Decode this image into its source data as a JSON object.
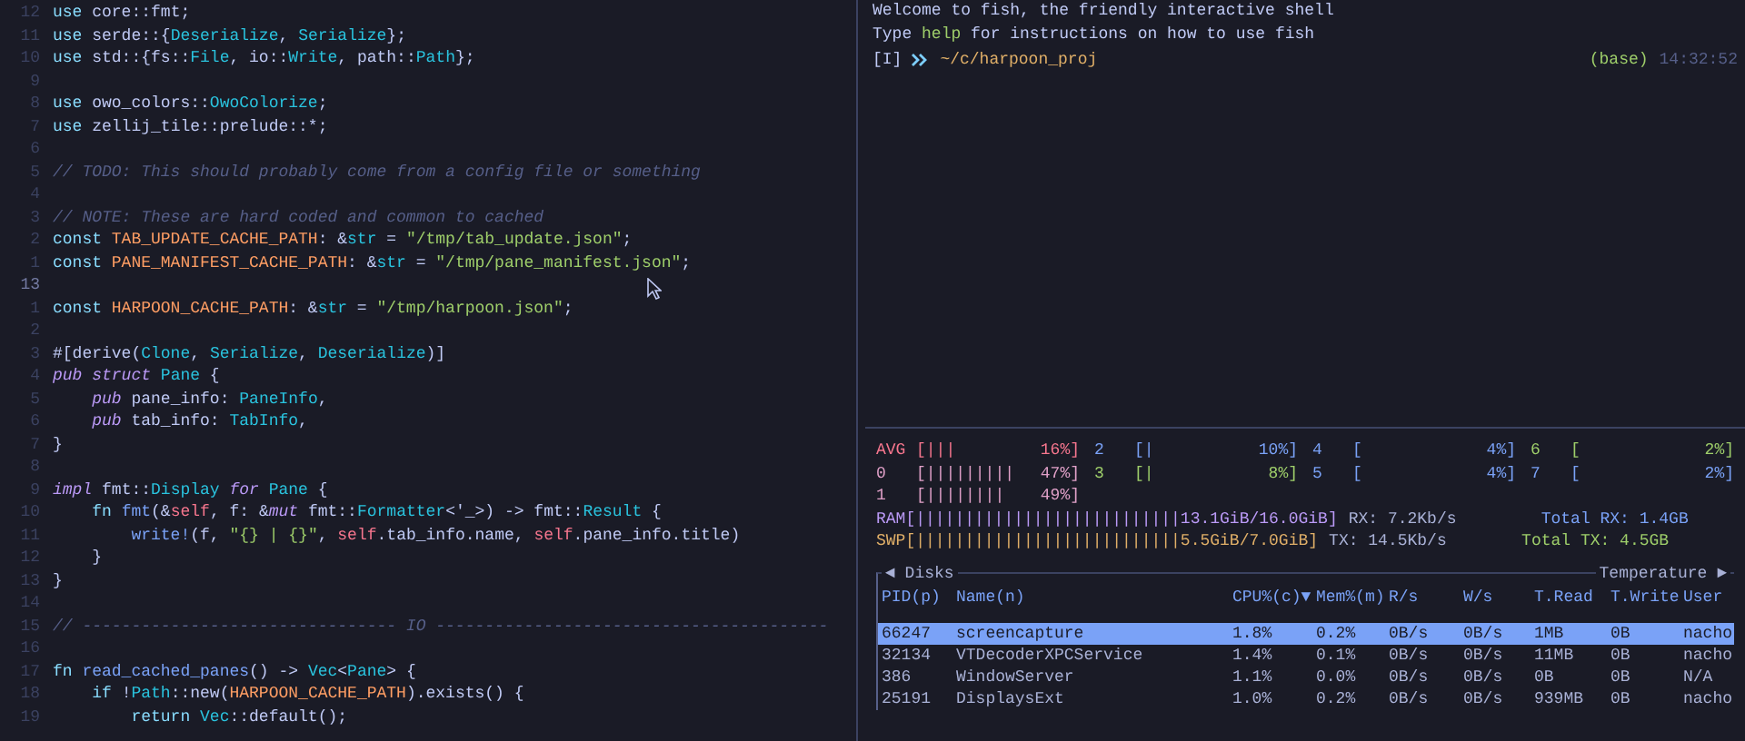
{
  "editor": {
    "lines": [
      {
        "number": "12",
        "current": false,
        "segments": [
          {
            "kind": "kw",
            "text": "use "
          },
          {
            "kind": "plain",
            "text": "core::fmt;"
          }
        ]
      },
      {
        "number": "11",
        "current": false,
        "segments": [
          {
            "kind": "kw",
            "text": "use "
          },
          {
            "kind": "plain",
            "text": "serde::{"
          },
          {
            "kind": "type",
            "text": "Deserialize"
          },
          {
            "kind": "plain",
            "text": ", "
          },
          {
            "kind": "type",
            "text": "Serialize"
          },
          {
            "kind": "plain",
            "text": "};"
          }
        ]
      },
      {
        "number": "10",
        "current": false,
        "segments": [
          {
            "kind": "kw",
            "text": "use "
          },
          {
            "kind": "plain",
            "text": "std::{fs::"
          },
          {
            "kind": "type",
            "text": "File"
          },
          {
            "kind": "plain",
            "text": ", io::"
          },
          {
            "kind": "type",
            "text": "Write"
          },
          {
            "kind": "plain",
            "text": ", path::"
          },
          {
            "kind": "type",
            "text": "Path"
          },
          {
            "kind": "plain",
            "text": "};"
          }
        ]
      },
      {
        "number": "9",
        "current": false
      },
      {
        "number": "8",
        "current": false,
        "segments": [
          {
            "kind": "kw",
            "text": "use "
          },
          {
            "kind": "plain",
            "text": "owo_colors::"
          },
          {
            "kind": "type",
            "text": "OwoColorize"
          },
          {
            "kind": "plain",
            "text": ";"
          }
        ]
      },
      {
        "number": "7",
        "current": false,
        "segments": [
          {
            "kind": "kw",
            "text": "use "
          },
          {
            "kind": "plain",
            "text": "zellij_tile::prelude::*;"
          }
        ]
      },
      {
        "number": "6",
        "current": false
      },
      {
        "number": "5",
        "current": false,
        "segments": [
          {
            "kind": "comment",
            "text": "// TODO: This should probably come from a config file or something"
          }
        ]
      },
      {
        "number": "4",
        "current": false
      },
      {
        "number": "3",
        "current": false,
        "segments": [
          {
            "kind": "comment",
            "text": "// NOTE: These are hard coded and common to cached"
          }
        ]
      },
      {
        "number": "2",
        "current": false,
        "segments": [
          {
            "kind": "kw",
            "text": "const "
          },
          {
            "kind": "constname",
            "text": "TAB_UPDATE_CACHE_PATH"
          },
          {
            "kind": "plain",
            "text": ": &"
          },
          {
            "kind": "type",
            "text": "str"
          },
          {
            "kind": "plain",
            "text": " = "
          },
          {
            "kind": "string",
            "text": "\"/tmp/tab_update.json\""
          },
          {
            "kind": "plain",
            "text": ";"
          }
        ]
      },
      {
        "number": "1",
        "current": false,
        "segments": [
          {
            "kind": "kw",
            "text": "const "
          },
          {
            "kind": "constname",
            "text": "PANE_MANIFEST_CACHE_PATH"
          },
          {
            "kind": "plain",
            "text": ": &"
          },
          {
            "kind": "type",
            "text": "str"
          },
          {
            "kind": "plain",
            "text": " = "
          },
          {
            "kind": "string",
            "text": "\"/tmp/pane_manifest.json\""
          },
          {
            "kind": "plain",
            "text": ";"
          }
        ]
      },
      {
        "number": "13",
        "current": true
      },
      {
        "number": "1",
        "current": false,
        "segments": [
          {
            "kind": "kw",
            "text": "const "
          },
          {
            "kind": "constname",
            "text": "HARPOON_CACHE_PATH"
          },
          {
            "kind": "plain",
            "text": ": &"
          },
          {
            "kind": "type",
            "text": "str"
          },
          {
            "kind": "plain",
            "text": " = "
          },
          {
            "kind": "string",
            "text": "\"/tmp/harpoon.json\""
          },
          {
            "kind": "plain",
            "text": ";"
          }
        ]
      },
      {
        "number": "2",
        "current": false
      },
      {
        "number": "3",
        "current": false,
        "segments": [
          {
            "kind": "plain",
            "text": "#[derive("
          },
          {
            "kind": "type",
            "text": "Clone"
          },
          {
            "kind": "plain",
            "text": ", "
          },
          {
            "kind": "type",
            "text": "Serialize"
          },
          {
            "kind": "plain",
            "text": ", "
          },
          {
            "kind": "type",
            "text": "Deserialize"
          },
          {
            "kind": "plain",
            "text": ")]"
          }
        ]
      },
      {
        "number": "4",
        "current": false,
        "segments": [
          {
            "kind": "mod",
            "text": "pub struct "
          },
          {
            "kind": "type",
            "text": "Pane"
          },
          {
            "kind": "plain",
            "text": " {"
          }
        ]
      },
      {
        "number": "5",
        "current": false,
        "segments": [
          {
            "kind": "mod",
            "text": "    pub "
          },
          {
            "kind": "plain",
            "text": "pane_info: "
          },
          {
            "kind": "type",
            "text": "PaneInfo"
          },
          {
            "kind": "plain",
            "text": ","
          }
        ]
      },
      {
        "number": "6",
        "current": false,
        "segments": [
          {
            "kind": "mod",
            "text": "    pub "
          },
          {
            "kind": "plain",
            "text": "tab_info: "
          },
          {
            "kind": "type",
            "text": "TabInfo"
          },
          {
            "kind": "plain",
            "text": ","
          }
        ]
      },
      {
        "number": "7",
        "current": false,
        "segments": [
          {
            "kind": "plain",
            "text": "}"
          }
        ]
      },
      {
        "number": "8",
        "current": false
      },
      {
        "number": "9",
        "current": false,
        "segments": [
          {
            "kind": "mod",
            "text": "impl "
          },
          {
            "kind": "plain",
            "text": "fmt::"
          },
          {
            "kind": "type",
            "text": "Display"
          },
          {
            "kind": "mod",
            "text": " for "
          },
          {
            "kind": "type",
            "text": "Pane"
          },
          {
            "kind": "plain",
            "text": " {"
          }
        ]
      },
      {
        "number": "10",
        "current": false,
        "segments": [
          {
            "kind": "kw",
            "text": "    fn "
          },
          {
            "kind": "func",
            "text": "fmt"
          },
          {
            "kind": "plain",
            "text": "(&"
          },
          {
            "kind": "self",
            "text": "self"
          },
          {
            "kind": "plain",
            "text": ", f: &"
          },
          {
            "kind": "mod",
            "text": "mut "
          },
          {
            "kind": "plain",
            "text": "fmt::"
          },
          {
            "kind": "type",
            "text": "Formatter"
          },
          {
            "kind": "plain",
            "text": "<'_>) -> fmt::"
          },
          {
            "kind": "type",
            "text": "Result"
          },
          {
            "kind": "plain",
            "text": " {"
          }
        ]
      },
      {
        "number": "11",
        "current": false,
        "segments": [
          {
            "kind": "func",
            "text": "        write!"
          },
          {
            "kind": "plain",
            "text": "(f, "
          },
          {
            "kind": "string",
            "text": "\"{} | {}\""
          },
          {
            "kind": "plain",
            "text": ", "
          },
          {
            "kind": "self",
            "text": "self"
          },
          {
            "kind": "plain",
            "text": ".tab_info.name, "
          },
          {
            "kind": "self",
            "text": "self"
          },
          {
            "kind": "plain",
            "text": ".pane_info.title)"
          }
        ]
      },
      {
        "number": "12",
        "current": false,
        "segments": [
          {
            "kind": "plain",
            "text": "    }"
          }
        ]
      },
      {
        "number": "13",
        "current": false,
        "segments": [
          {
            "kind": "plain",
            "text": "}"
          }
        ]
      },
      {
        "number": "14",
        "current": false
      },
      {
        "number": "15",
        "current": false,
        "segments": [
          {
            "kind": "comment",
            "text": "// -------------------------------- IO ----------------------------------------"
          }
        ]
      },
      {
        "number": "16",
        "current": false
      },
      {
        "number": "17",
        "current": false,
        "segments": [
          {
            "kind": "kw",
            "text": "fn "
          },
          {
            "kind": "func",
            "text": "read_cached_panes"
          },
          {
            "kind": "plain",
            "text": "() -> "
          },
          {
            "kind": "type",
            "text": "Vec"
          },
          {
            "kind": "plain",
            "text": "<"
          },
          {
            "kind": "type",
            "text": "Pane"
          },
          {
            "kind": "plain",
            "text": "> {"
          }
        ]
      },
      {
        "number": "18",
        "current": false,
        "segments": [
          {
            "kind": "kw",
            "text": "    if "
          },
          {
            "kind": "plain",
            "text": "!"
          },
          {
            "kind": "type",
            "text": "Path"
          },
          {
            "kind": "plain",
            "text": "::new("
          },
          {
            "kind": "constname",
            "text": "HARPOON_CACHE_PATH"
          },
          {
            "kind": "plain",
            "text": ").exists() {"
          }
        ]
      },
      {
        "number": "19",
        "current": false,
        "segments": [
          {
            "kind": "kw",
            "text": "        return "
          },
          {
            "kind": "type",
            "text": "Vec"
          },
          {
            "kind": "plain",
            "text": "::default();"
          }
        ]
      }
    ]
  },
  "terminal": {
    "lines": [
      {
        "segments": [
          {
            "kind": "plain",
            "text": "Welcome to fish, the friendly interactive shell"
          }
        ]
      },
      {
        "segments": [
          {
            "kind": "plain",
            "text": "Type "
          },
          {
            "kind": "string",
            "text": "help"
          },
          {
            "kind": "plain",
            "text": " for instructions on how to use fish"
          }
        ]
      }
    ],
    "prompt": {
      "mode": "[I]",
      "path": "~/c/harpoon_proj",
      "env": "(base)",
      "time": "14:32:52"
    }
  },
  "monitor": {
    "cpus": [
      {
        "label": "AVG",
        "bar": "[|||",
        "percent": "16%]",
        "color": "#f7768e"
      },
      {
        "label": "2",
        "bar": "[|",
        "percent": "10%]",
        "color": "#7aa2f7"
      },
      {
        "label": "4",
        "bar": "[",
        "percent": "4%]",
        "color": "#7aa2f7"
      },
      {
        "label": "6",
        "bar": "[",
        "percent": "2%]",
        "color": "#9ece6a"
      },
      {
        "label": "0",
        "bar": "[|||||||||",
        "percent": "47%]",
        "color": "#e0a0c8"
      },
      {
        "label": "3",
        "bar": "[|",
        "percent": "8%]",
        "color": "#9ece6a"
      },
      {
        "label": "5",
        "bar": "[",
        "percent": "4%]",
        "color": "#7aa2f7"
      },
      {
        "label": "7",
        "bar": "[",
        "percent": "2%]",
        "color": "#7aa2f7"
      },
      {
        "label": "1",
        "bar": "[||||||||",
        "percent": "49%]",
        "color": "#e0a0c8"
      }
    ],
    "memory": [
      {
        "bar": "RAM[|||||||||||||||||||||||||||13.1GiB/16.0GiB]",
        "color": "#bb9af7",
        "rate": "RX: 7.2Kb/s",
        "total": "Total RX: 1.4GB"
      },
      {
        "bar": "SWP[|||||||||||||||||||||||||||5.5GiB/7.0GiB]",
        "color": "#e0af68",
        "rate": "TX: 14.5Kb/s",
        "total": "Total TX: 4.5GB"
      }
    ],
    "processes": {
      "left_tab": "◄ Disks",
      "right_tab": "Temperature ►",
      "columns": [
        "PID(p)",
        "Name(n)",
        "CPU%(c)▼",
        "Mem%(m)",
        "R/s",
        "W/s",
        "T.Read",
        "T.Write",
        "User"
      ],
      "rows": [
        {
          "selected": true,
          "cells": [
            "66247",
            "screencapture",
            "1.8%",
            "0.2%",
            "0B/s",
            "0B/s",
            "1MB",
            "0B",
            "nacho"
          ]
        },
        {
          "selected": false,
          "cells": [
            "32134",
            "VTDecoderXPCService",
            "1.4%",
            "0.1%",
            "0B/s",
            "0B/s",
            "11MB",
            "0B",
            "nacho"
          ]
        },
        {
          "selected": false,
          "cells": [
            "386",
            "WindowServer",
            "1.1%",
            "0.0%",
            "0B/s",
            "0B/s",
            "0B",
            "0B",
            "N/A"
          ]
        },
        {
          "selected": false,
          "cells": [
            "25191",
            "DisplaysExt",
            "1.0%",
            "0.2%",
            "0B/s",
            "0B/s",
            "939MB",
            "0B",
            "nacho"
          ]
        }
      ]
    }
  }
}
